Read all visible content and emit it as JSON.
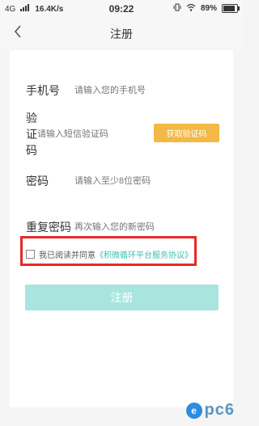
{
  "status_bar": {
    "network": "4G",
    "signal_icon": "signal-icon",
    "speed": "16.4K/s",
    "time": "09:22",
    "vibrate_icon": "vibrate-icon",
    "wifi_icon": "wifi-icon",
    "battery_percent": "89%",
    "battery_level": 0.89
  },
  "nav": {
    "back_icon": "chevron-left-icon",
    "title": "注册"
  },
  "form": {
    "phone": {
      "label": "手机号",
      "placeholder": "请输入您的手机号"
    },
    "code": {
      "label": "验证码",
      "placeholder": "请输入短信验证码"
    },
    "send_code_label": "获取验证码",
    "password": {
      "label": "密码",
      "placeholder": "请输入至少8位密码"
    },
    "repeat_password": {
      "label": "重复密码",
      "placeholder": "再次输入您的新密码"
    }
  },
  "agreement": {
    "text": "我已阅读并同意",
    "link": "《积微循环平台服务协议》"
  },
  "submit_label": "注册",
  "colors": {
    "accent": "#f4b846",
    "submit_bg": "#a9e5df",
    "link": "#3cbfae",
    "highlight": "#e52a2a"
  },
  "watermark": {
    "mark": "e",
    "text": "pc6"
  }
}
